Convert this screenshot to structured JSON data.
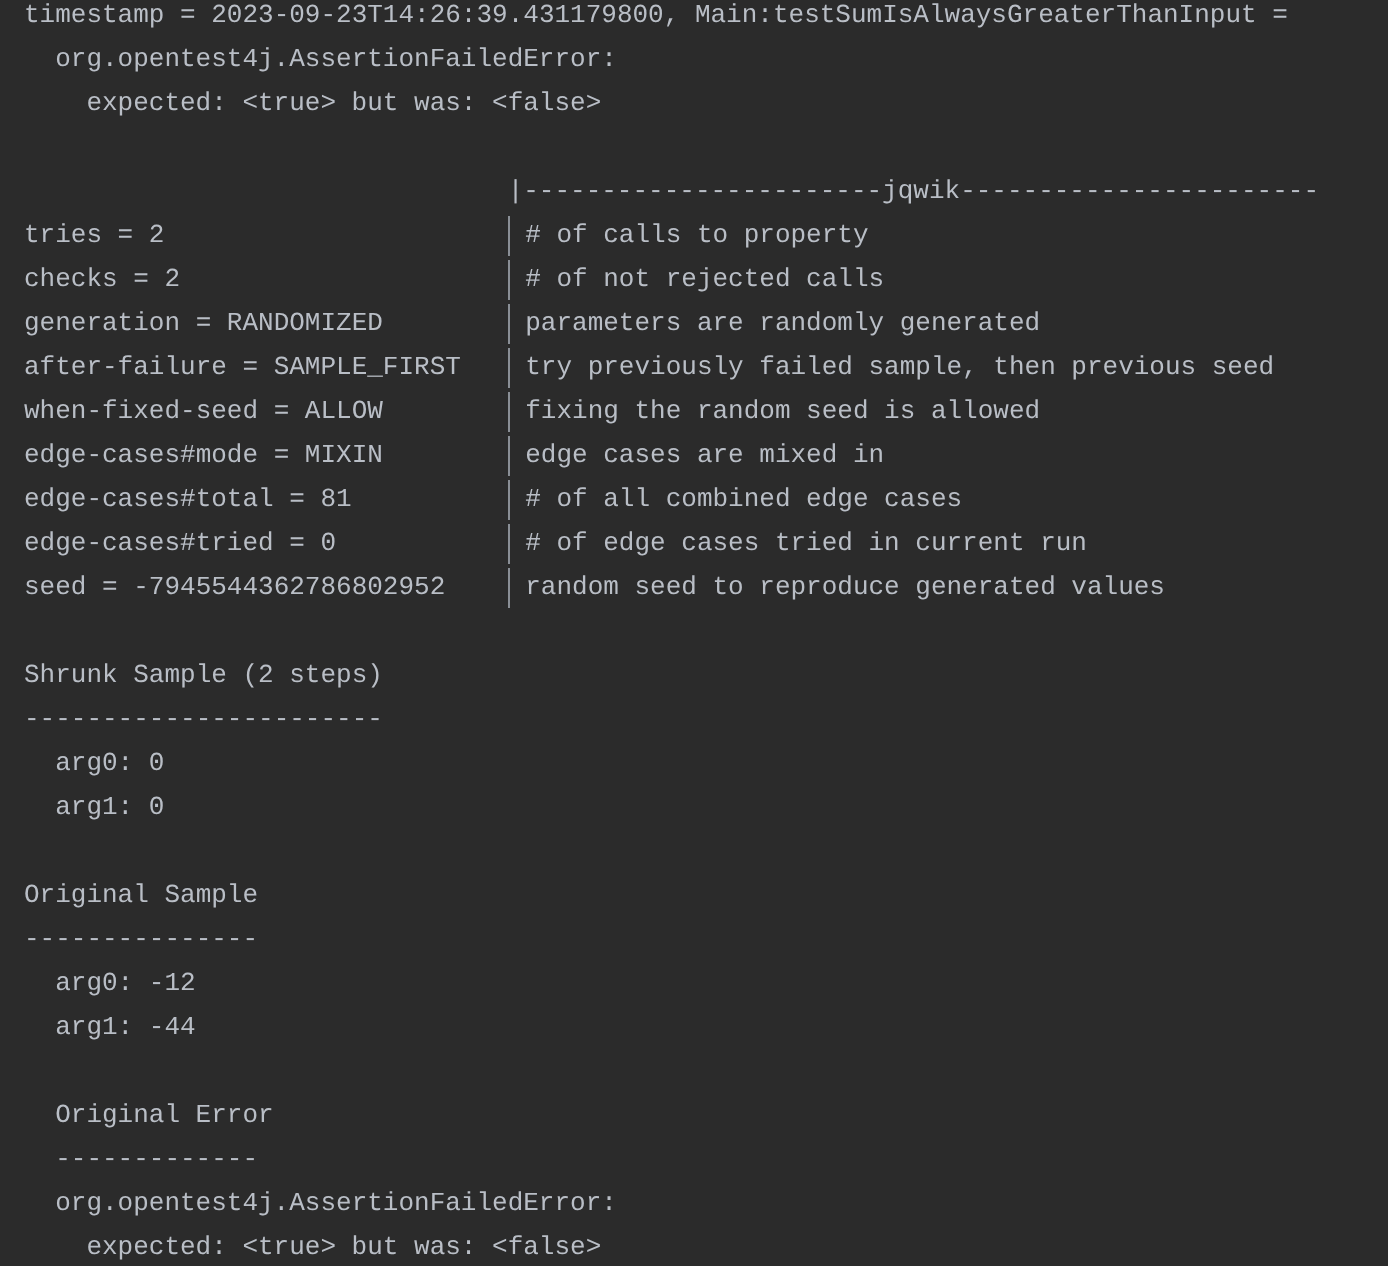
{
  "failure": {
    "header": "timestamp = 2023-09-23T14:26:39.431179800, Main:testSumIsAlwaysGreaterThanInput =",
    "children": [
      {
        "text": "org.opentest4j.AssertionFailedError:",
        "children": [
          {
            "text": "expected: <true> but was: <false>"
          }
        ]
      }
    ]
  },
  "jqwik": {
    "header": "|-----------------------jqwik-----------------------",
    "rows": [
      {
        "key": "tries = 2",
        "description": "# of calls to property"
      },
      {
        "key": "checks = 2",
        "description": "# of not rejected calls"
      },
      {
        "key": "generation = RANDOMIZED",
        "description": "parameters are randomly generated"
      },
      {
        "key": "after-failure = SAMPLE_FIRST",
        "description": "try previously failed sample, then previous seed"
      },
      {
        "key": "when-fixed-seed = ALLOW",
        "description": "fixing the random seed is allowed"
      },
      {
        "key": "edge-cases#mode = MIXIN",
        "description": "edge cases are mixed in"
      },
      {
        "key": "edge-cases#total = 81",
        "description": "# of all combined edge cases"
      },
      {
        "key": "edge-cases#tried = 0",
        "description": "# of edge cases tried in current run"
      },
      {
        "key": "seed = -7945544362786802952",
        "description": "random seed to reproduce generated values"
      }
    ]
  },
  "sections": [
    {
      "title": "Shrunk Sample (2 steps)",
      "rule": "-----------------------",
      "args": [
        "arg0: 0",
        "arg1: 0"
      ]
    },
    {
      "title": "Original Sample",
      "rule": "---------------",
      "args": [
        "arg0: -12",
        "arg1: -44"
      ],
      "error": {
        "title": "Original Error",
        "rule": "-------------",
        "children": [
          {
            "text": "org.opentest4j.AssertionFailedError:",
            "children": [
              {
                "text": "expected: <true> but was: <false>"
              }
            ]
          }
        ]
      }
    }
  ]
}
